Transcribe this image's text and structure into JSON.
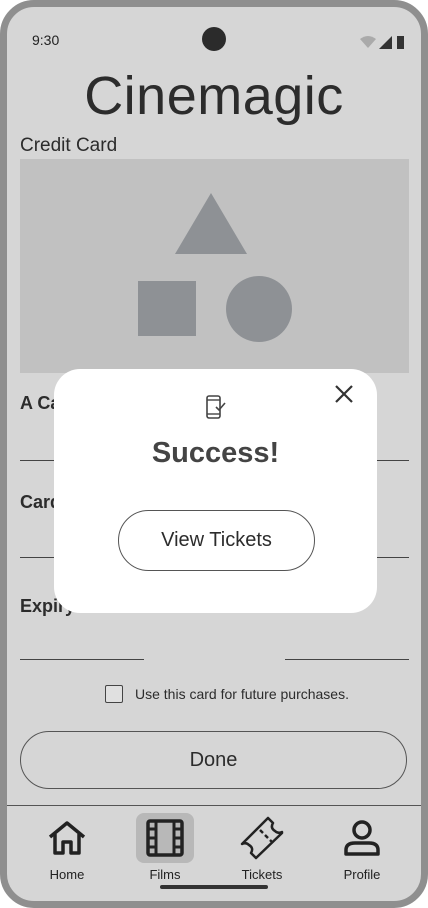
{
  "status_bar": {
    "time": "9:30"
  },
  "app": {
    "title": "Cinemagic"
  },
  "form": {
    "section_label": "Credit Card",
    "fields": [
      {
        "label": "A Ca"
      },
      {
        "label": "Card"
      },
      {
        "label": "Expiry"
      }
    ],
    "checkbox_label": "Use this card for future purchases.",
    "done_label": "Done"
  },
  "modal": {
    "title": "Success!",
    "button_label": "View Tickets",
    "icon": "phone-check-icon"
  },
  "nav": {
    "items": [
      {
        "label": "Home",
        "icon": "home-icon"
      },
      {
        "label": "Films",
        "icon": "film-icon",
        "active": true
      },
      {
        "label": "Tickets",
        "icon": "ticket-icon"
      },
      {
        "label": "Profile",
        "icon": "user-icon"
      }
    ]
  },
  "colors": {
    "background": "#d6d6d6",
    "image_placeholder": "#c1c1c1",
    "shape": "#8e9195",
    "modal": "#ffffff"
  }
}
